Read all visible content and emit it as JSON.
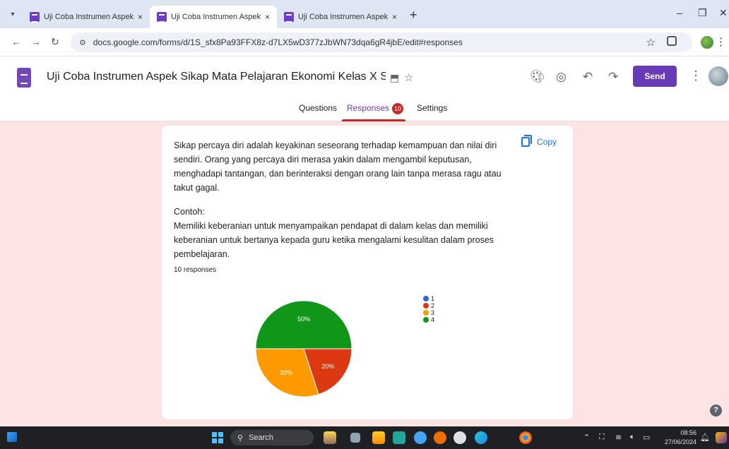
{
  "browser": {
    "tabs": [
      {
        "title": "Uji Coba Instrumen Aspek Keter",
        "active": false
      },
      {
        "title": "Uji Coba Instrumen Aspek Sikap",
        "active": true
      },
      {
        "title": "Uji Coba Instrumen Aspek Peng",
        "active": false
      }
    ],
    "new_tab": "+",
    "close_glyph": "×",
    "url": "docs.google.com/forms/d/1S_sfx8Pa93FFX8z-d7LX5wD377zJbWN73dqa6gR4jbE/edit#responses"
  },
  "form": {
    "title": "Uji Coba Instrumen Aspek Sikap Mata Pelajaran Ekonomi Kelas X SMK Neg",
    "send_label": "Send",
    "tabs": {
      "questions": "Questions",
      "responses": "Responses",
      "responses_count": "10",
      "settings": "Settings"
    }
  },
  "card": {
    "paragraph1": "Sikap percaya diri adalah keyakinan seseorang terhadap kemampuan dan nilai diri sendiri. Orang yang percaya diri merasa yakin dalam mengambil keputusan, menghadapi tantangan, dan berinteraksi dengan orang lain tanpa merasa ragu atau takut gagal.",
    "example_label": "Contoh:",
    "paragraph2": "Memiliki keberanian untuk menyampaikan pendapat di dalam kelas dan memiliki keberanian untuk bertanya kepada guru ketika mengalami kesulitan dalam proses pembelajaran.",
    "copy_label": "Copy",
    "responses_label": "10 responses"
  },
  "chart_data": {
    "type": "pie",
    "categories": [
      "1",
      "2",
      "3",
      "4"
    ],
    "values": [
      0,
      20,
      30,
      50
    ],
    "labels": [
      "",
      "20%",
      "30%",
      "50%"
    ],
    "colors": [
      "#3366cc",
      "#dc3912",
      "#ff9900",
      "#109618"
    ],
    "legend_position": "right"
  },
  "taskbar": {
    "search_label": "Search",
    "time": "08:56",
    "date": "27/06/2024"
  },
  "icons": {
    "palette": "palette-icon",
    "preview": "eye-icon",
    "undo": "undo-icon",
    "redo": "redo-icon",
    "help": "?"
  }
}
